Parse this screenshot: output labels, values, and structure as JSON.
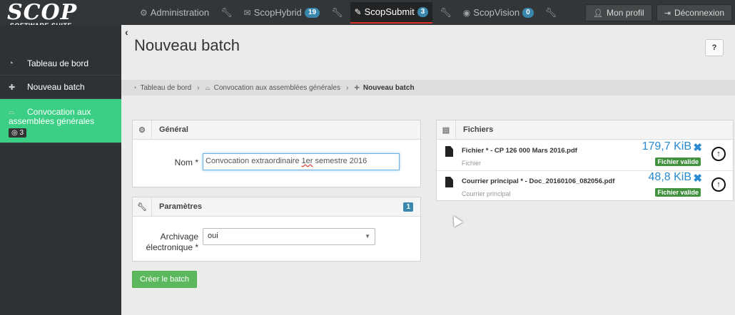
{
  "brand": {
    "logo": "SCOP",
    "tagline": "SOFTWARE SUITE"
  },
  "topnav": {
    "items": [
      {
        "label": "Administration",
        "icon": "gear-icon"
      },
      {
        "label": "ScopHybrid",
        "icon": "envelope-icon",
        "badge": "19"
      },
      {
        "label": "ScopSubmit",
        "icon": "paperclip-icon",
        "badge": "3",
        "active": true
      },
      {
        "label": "ScopVision",
        "icon": "eye-icon",
        "badge": "0"
      }
    ],
    "profile": "Mon profil",
    "logout": "Déconnexion"
  },
  "sidebar": {
    "items": [
      {
        "label": "Tableau de bord",
        "icon": "dashboard-icon"
      },
      {
        "label": "Nouveau batch",
        "icon": "plus-icon"
      },
      {
        "label": "Convocation aux assemblées générales",
        "icon": "inbox-icon",
        "count": "3",
        "active": true
      }
    ]
  },
  "page": {
    "title": "Nouveau batch",
    "help": "?"
  },
  "breadcrumb": [
    "Tableau de bord",
    "Convocation aux assemblées générales",
    "Nouveau batch"
  ],
  "general": {
    "title": "Général",
    "name_label": "Nom *",
    "name_value_a": "Convocation extraordinaire ",
    "name_value_b": "1er",
    "name_value_c": " semestre 2016"
  },
  "params": {
    "title": "Paramètres",
    "count": "1",
    "archive_label_1": "Archivage",
    "archive_label_2": "électronique *",
    "archive_value": "oui"
  },
  "submit_label": "Créer le batch",
  "files": {
    "title": "Fichiers",
    "items": [
      {
        "name": "Fichier * - CP 126 000 Mars 2016.pdf",
        "type": "Fichier",
        "size": "179,7 KiB",
        "status": "Fichier valide"
      },
      {
        "name": "Courrier principal * - Doc_20160106_082056.pdf",
        "type": "Courrier principal",
        "size": "48,8 KiB",
        "status": "Fichier valide"
      }
    ]
  },
  "colors": {
    "accent_green": "#3bcf85",
    "badge_blue": "#3a87ad",
    "valid_green": "#41913f",
    "size_blue": "#2a8bd1"
  }
}
